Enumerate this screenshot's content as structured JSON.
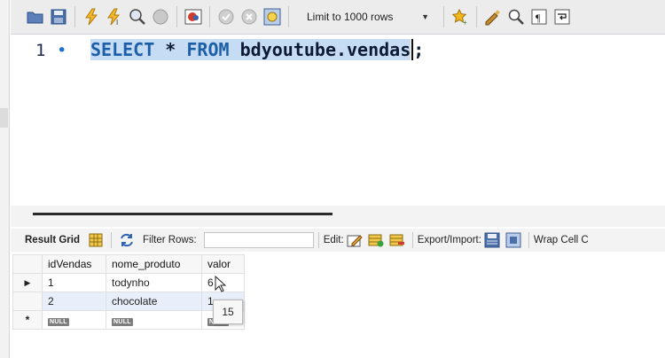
{
  "toolbar": {
    "limit_select": "Limit to 1000 rows",
    "icons": [
      "open-folder-icon",
      "save-icon",
      "execute-icon",
      "execute-current-icon",
      "explain-icon",
      "stop-icon",
      "toggle-output-icon",
      "commit-icon",
      "rollback-icon",
      "autocommit-icon",
      "favorite-icon",
      "beautify-icon",
      "find-icon",
      "invisible-chars-icon",
      "wrap-icon"
    ]
  },
  "editor": {
    "line_number": "1",
    "line_marker": "•",
    "keyword_select": "SELECT",
    "star": "*",
    "keyword_from": "FROM",
    "table": "bdyoutube.vendas",
    "terminator": ";"
  },
  "result_toolbar": {
    "result_grid": "Result Grid",
    "filter_rows": "Filter Rows:",
    "filter_value": "",
    "edit": "Edit:",
    "export_import": "Export/Import:",
    "wrap_cell": "Wrap Cell C"
  },
  "grid": {
    "columns": [
      "idVendas",
      "nome_produto",
      "valor"
    ],
    "rows": [
      {
        "marker": "▶",
        "cells": [
          "1",
          "todynho",
          "6"
        ]
      },
      {
        "marker": "",
        "cells": [
          "2",
          "chocolate",
          "1"
        ]
      },
      {
        "marker": "*",
        "cells": [
          "NULL",
          "NULL",
          "NULL"
        ]
      }
    ]
  },
  "tooltip": "15",
  "colors": {
    "keyword": "#1c5fa8",
    "selection": "#c6dcf4",
    "alt_row": "#e8effa"
  }
}
